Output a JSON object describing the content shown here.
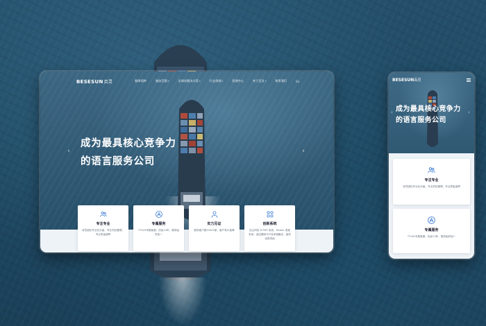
{
  "desktop": {
    "logo": {
      "brand": "BESESUN",
      "cn": "百灵"
    },
    "nav": [
      {
        "label": "翻译语种",
        "caret": false
      },
      {
        "label": "服务范围",
        "caret": true
      },
      {
        "label": "全球化解决方案",
        "caret": true
      },
      {
        "label": "行业领域",
        "caret": true
      },
      {
        "label": "资源中心",
        "caret": false
      },
      {
        "label": "关于百灵",
        "caret": true
      },
      {
        "label": "联系我们",
        "caret": false
      },
      {
        "label": "En",
        "caret": false
      }
    ],
    "hero": {
      "line1": "成为最具核心竞争力",
      "line2": "的语言服务公司"
    },
    "cards": [
      {
        "icon": "team-icon",
        "title": "专注专业",
        "desc": "译员团队专业化分级，专业项目管理，专业质量保障"
      },
      {
        "icon": "target-icon",
        "title": "专属服务",
        "desc": "7*24H专属客服，历经13年，服务始终如一"
      },
      {
        "icon": "user-icon",
        "title": "实力见证",
        "desc": "服务客户超20000家，客户有口皆碑"
      },
      {
        "icon": "grid-icon",
        "title": "创新系统",
        "desc": "自主研发 B-TMS 系统，Yadeer 语音系统，适应翻译与IT技术相融合，高效优质持续"
      }
    ]
  },
  "mobile": {
    "logo": {
      "brand": "BESESUN",
      "cn": "百灵"
    },
    "hero": {
      "line1": "成为最具核心竞争力",
      "line2": "的语言服务公司"
    },
    "cards": [
      {
        "icon": "team-icon",
        "title": "专注专业",
        "desc": "译员团队专业化分级，专业项目管理，专业质量保障"
      },
      {
        "icon": "target-icon",
        "title": "专属服务",
        "desc": "7*24H专属客服，历经13年，服务始终如一"
      }
    ]
  },
  "colors": {
    "accent": "#3a7bd5",
    "ocean": "#1f4a64"
  },
  "arrows": {
    "left": "‹",
    "right": "›"
  }
}
